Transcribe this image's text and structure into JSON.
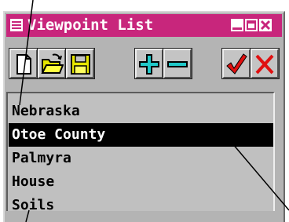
{
  "window": {
    "title": "Viewpoint List",
    "icon": "window-menu-icon",
    "controls": [
      "minimize-icon",
      "maximize-icon",
      "close-icon"
    ],
    "accent_color": "#c8267c"
  },
  "toolbar": {
    "buttons": [
      {
        "name": "new-file-button",
        "icon": "new-document-icon"
      },
      {
        "name": "open-file-button",
        "icon": "open-folder-icon"
      },
      {
        "name": "save-file-button",
        "icon": "floppy-disk-icon"
      },
      {
        "name": "add-viewpoint-button",
        "icon": "plus-icon"
      },
      {
        "name": "remove-viewpoint-button",
        "icon": "minus-icon"
      },
      {
        "name": "apply-button",
        "icon": "checkmark-icon"
      },
      {
        "name": "cancel-button",
        "icon": "x-icon"
      }
    ]
  },
  "list": {
    "items": [
      "Nebraska",
      "Otoe County",
      "Palmyra",
      "House",
      "Soils"
    ],
    "selected_index": 1
  }
}
